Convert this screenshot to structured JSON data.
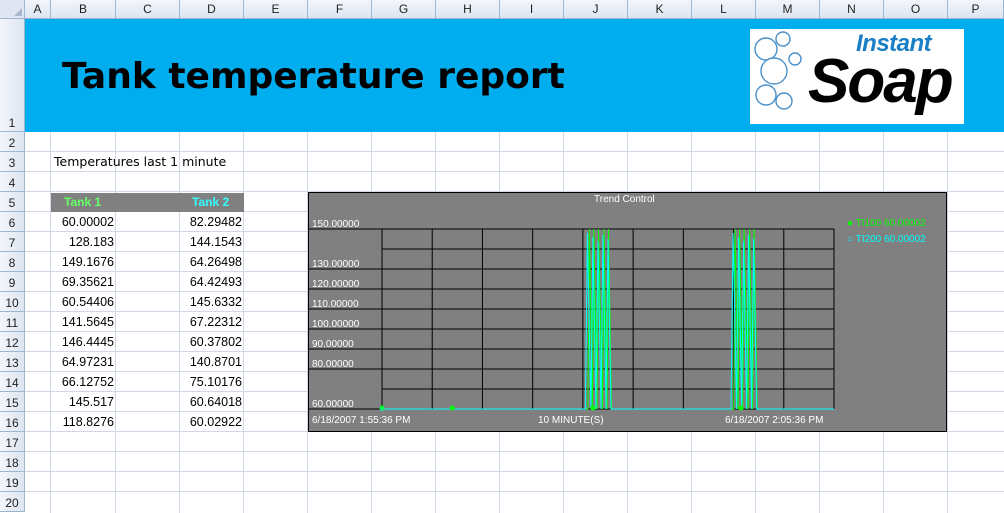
{
  "columns": [
    "A",
    "B",
    "C",
    "D",
    "E",
    "F",
    "G",
    "H",
    "I",
    "J",
    "K",
    "L",
    "M",
    "N",
    "O",
    "P"
  ],
  "rows": [
    "1",
    "2",
    "3",
    "4",
    "5",
    "6",
    "7",
    "8",
    "9",
    "10",
    "11",
    "12",
    "13",
    "14",
    "15",
    "16",
    "17",
    "18",
    "19",
    "20"
  ],
  "report": {
    "title": "Tank temperature report",
    "subtitle": "Temperatures last 1 minute"
  },
  "logo": {
    "line1": "Instant",
    "line2": "Soap"
  },
  "table": {
    "headers": [
      "Tank 1",
      "Tank 2"
    ],
    "header_colors": [
      "#66ff66",
      "#33ffff"
    ],
    "rows": [
      [
        "60.00002",
        "82.29482"
      ],
      [
        "128.183",
        "144.1543"
      ],
      [
        "149.1676",
        "64.26498"
      ],
      [
        "69.35621",
        "64.42493"
      ],
      [
        "60.54406",
        "145.6332"
      ],
      [
        "141.5645",
        "67.22312"
      ],
      [
        "146.4445",
        "60.37802"
      ],
      [
        "64.97231",
        "140.8701"
      ],
      [
        "66.12752",
        "75.10176"
      ],
      [
        "145.517",
        "60.64018"
      ],
      [
        "118.8276",
        "60.02922"
      ]
    ]
  },
  "colors": {
    "banner": "#00aeef",
    "tank1": "#00ff00",
    "tank2": "#00ffff",
    "chart_bg": "#808080"
  },
  "chart_data": {
    "type": "line",
    "title": "Trend Control",
    "ylim": [
      60,
      150
    ],
    "y_ticks": [
      "150.00000",
      "130.00000",
      "120.00000",
      "110.00000",
      "100.00000",
      "90.00000",
      "80.00000",
      "60.00000"
    ],
    "x_start_label": "6/18/2007 1:55:36 PM",
    "x_span_label": "10 MINUTE(S)",
    "x_end_label": "6/18/2007 2:05:36 PM",
    "legend": [
      "TI100 60.00002",
      "TI200 60.00002"
    ],
    "legend_position": "right",
    "grid": true,
    "series": [
      {
        "name": "TI100",
        "color": "#00ff00",
        "x": [
          0,
          4.1,
          4.13,
          4.19,
          4.22,
          4.28,
          4.31,
          4.39,
          4.42,
          4.48,
          4.51,
          4.57,
          4.6,
          7.0,
          7.03,
          7.09,
          7.12,
          7.18,
          7.21,
          7.29,
          7.32,
          7.38,
          7.41,
          7.47,
          7.5,
          9.0
        ],
        "y": [
          60,
          60,
          150,
          60,
          150,
          60,
          150,
          60,
          150,
          60,
          150,
          60,
          60,
          60,
          150,
          60,
          150,
          60,
          150,
          60,
          150,
          60,
          150,
          60,
          60,
          60
        ]
      },
      {
        "name": "TI200",
        "color": "#00ffff",
        "x": [
          0,
          4.05,
          4.09,
          4.16,
          4.2,
          4.26,
          4.3,
          4.36,
          4.4,
          4.46,
          4.5,
          4.56,
          6.95,
          6.99,
          7.06,
          7.1,
          7.16,
          7.2,
          7.26,
          7.3,
          7.36,
          7.4,
          7.46,
          9.0
        ],
        "y": [
          60,
          60,
          148,
          60,
          146,
          60,
          144,
          60,
          147,
          60,
          145,
          60,
          60,
          148,
          60,
          146,
          60,
          144,
          60,
          147,
          60,
          145,
          60,
          60
        ]
      }
    ]
  }
}
